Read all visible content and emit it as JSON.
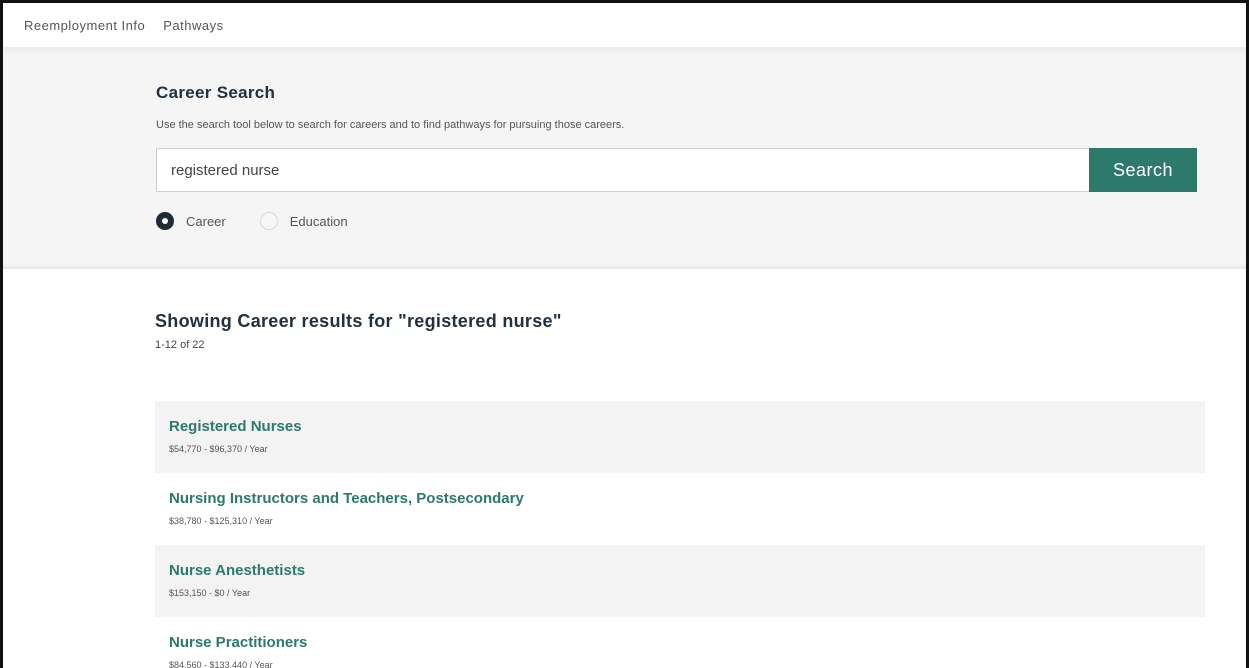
{
  "nav": {
    "items": [
      {
        "label": "Reemployment Info"
      },
      {
        "label": "Pathways"
      }
    ]
  },
  "search": {
    "title": "Career Search",
    "description": "Use the search tool below to search for careers and to find pathways for pursuing those careers.",
    "query": "registered nurse",
    "button_label": "Search",
    "options": [
      {
        "label": "Career",
        "selected": true
      },
      {
        "label": "Education",
        "selected": false
      }
    ]
  },
  "results": {
    "heading": "Showing Career results for \"registered nurse\"",
    "count": "1-12 of 22",
    "items": [
      {
        "title": "Registered Nurses",
        "salary": "$54,770 - $96,370 / Year"
      },
      {
        "title": "Nursing Instructors and Teachers, Postsecondary",
        "salary": "$38,780 - $125,310 / Year"
      },
      {
        "title": "Nurse Anesthetists",
        "salary": "$153,150 - $0 / Year"
      },
      {
        "title": "Nurse Practitioners",
        "salary": "$84,560 - $133,440 / Year"
      }
    ]
  },
  "colors": {
    "accent": "#2d7a6c",
    "heading": "#22313f",
    "panel_bg": "#f5f5f5"
  }
}
